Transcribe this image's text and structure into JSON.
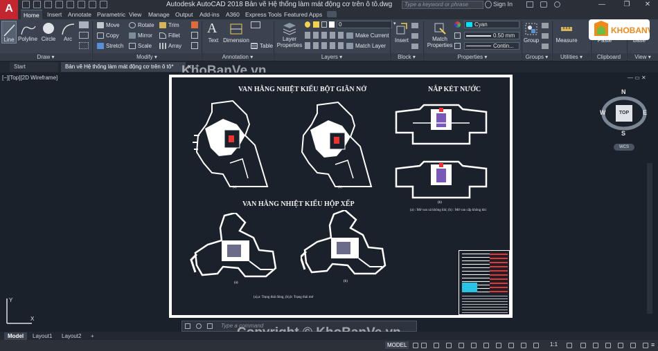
{
  "app": {
    "logo_letter": "A",
    "window_title": "Autodesk AutoCAD 2018    Bản vẽ Hệ thống làm mát động cơ trên ô tô.dwg",
    "search_placeholder": "Type a keyword or phrase",
    "sign_in": "Sign In"
  },
  "ribbon_tabs": [
    "Home",
    "Insert",
    "Annotate",
    "Parametric",
    "View",
    "Manage",
    "Output",
    "Add-ins",
    "A360",
    "Express Tools",
    "Featured Apps"
  ],
  "ribbon": {
    "draw": {
      "panel_label": "Draw ▾",
      "line": "Line",
      "polyline": "Polyline",
      "circle": "Circle",
      "arc": "Arc"
    },
    "modify": {
      "panel_label": "Modify ▾",
      "items": [
        "Move",
        "Rotate",
        "Trim",
        "Copy",
        "Mirror",
        "Fillet",
        "Stretch",
        "Scale",
        "Array"
      ]
    },
    "annotation": {
      "panel_label": "Annotation ▾",
      "text": "Text",
      "dimension": "Dimension",
      "table": "Table"
    },
    "layers": {
      "panel_label": "Layers ▾",
      "layer_properties": "Layer Properties",
      "layer_value": "0",
      "make_current": "Make Current",
      "match_layer": "Match Layer"
    },
    "block": {
      "panel_label": "Block ▾",
      "insert": "Insert"
    },
    "properties": {
      "panel_label": "Properties ▾",
      "match_properties": "Match Properties",
      "color_value": "Cyan",
      "lineweight_value": "0.50 mm",
      "linetype_value": "Contin..."
    },
    "groups": {
      "panel_label": "Groups ▾",
      "group": "Group"
    },
    "utilities": {
      "panel_label": "Utilities ▾",
      "measure": "Measure"
    },
    "clipboard": {
      "panel_label": "Clipboard",
      "paste": "Paste"
    },
    "view": {
      "panel_label": "View ▾",
      "base": "Base"
    }
  },
  "doc_tabs": {
    "start": "Start",
    "active": "Bản vẽ Hệ thống làm mát động cơ trên ô tô*"
  },
  "viewport": {
    "label": "[−][Top][2D Wireframe]"
  },
  "drawing": {
    "title_1": "VAN HẰNG NHIỆT KIỂU BỘT GIÃN NỞ",
    "title_2": "NẮP KÉT NƯỚC",
    "title_3": "VAN HẰNG NHIỆT KIỂU HỘP XẾP",
    "caption_radiator": "(a) : Mở van xả không khí;  (b) : Mở van cấp không khí",
    "caption_bellows": "(a),a: Trạng thái đóng, (b),b: Trạng thái mở"
  },
  "viewcube": {
    "n": "N",
    "s": "S",
    "e": "E",
    "w": "W",
    "top": "TOP",
    "wcs": "WCS"
  },
  "command": {
    "placeholder": "Type a command"
  },
  "layout_tabs": [
    "Model",
    "Layout1",
    "Layout2"
  ],
  "status": {
    "model": "MODEL",
    "scale": "1:1"
  },
  "watermark": {
    "top": "KhoBanVe.vn",
    "bottom": "Copyright © KhoBanVe.vn",
    "logo": "KHOBANVE"
  },
  "colors": {
    "accent_red": "#c3262e",
    "cyan_swatch": "#00e5ff",
    "logo_orange": "#f08a1c",
    "logo_green": "#6dbd45"
  }
}
